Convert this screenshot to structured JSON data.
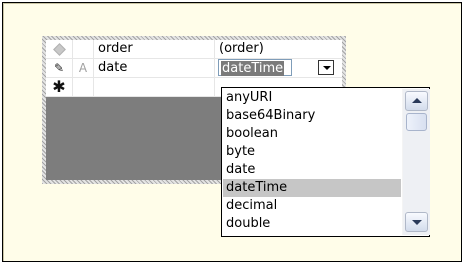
{
  "grid": {
    "header": {
      "name": "order",
      "type": "(order)"
    },
    "rows": [
      {
        "key_marker": "A",
        "name": "date",
        "type": "dateTime"
      }
    ]
  },
  "icons": {
    "header_row": "diamond-icon",
    "edit_row": "pencil-icon",
    "new_row": "asterisk-icon",
    "dropdown_arrow": "chevron-down-icon",
    "scroll_up": "scroll-up-icon",
    "scroll_down": "scroll-down-icon"
  },
  "dropdown": {
    "selected": "dateTime",
    "options": [
      "anyURI",
      "base64Binary",
      "boolean",
      "byte",
      "date",
      "dateTime",
      "decimal",
      "double"
    ]
  },
  "colors": {
    "panel_background": "#fffde9",
    "selected_option": "#c6c6c6",
    "empty_grid_area": "#7d7d7d"
  }
}
